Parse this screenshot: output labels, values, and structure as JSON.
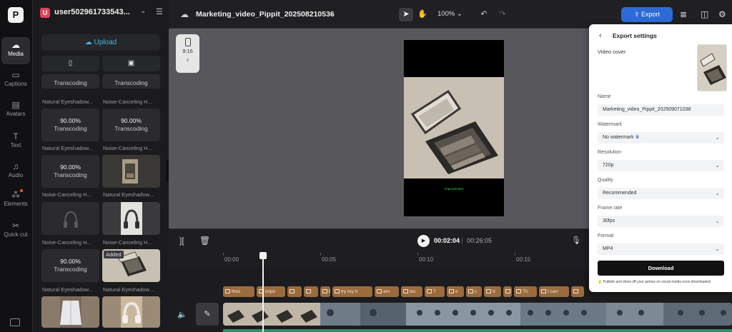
{
  "app": {
    "logo_glyph": "P",
    "user": {
      "initial": "U",
      "name": "user502961733543..."
    }
  },
  "rail": {
    "items": [
      {
        "id": "media",
        "label": "Media",
        "icon": "cloud-icon",
        "active": true
      },
      {
        "id": "captions",
        "label": "Captions",
        "icon": "captions-icon",
        "active": false
      },
      {
        "id": "avatars",
        "label": "Avatars",
        "icon": "avatar-icon",
        "active": false
      },
      {
        "id": "text",
        "label": "Text",
        "icon": "text-icon",
        "active": false
      },
      {
        "id": "audio",
        "label": "Audio",
        "icon": "music-icon",
        "active": false
      },
      {
        "id": "elements",
        "label": "Elements",
        "icon": "elements-icon",
        "active": false
      },
      {
        "id": "quickcut",
        "label": "Quick cut",
        "icon": "scissors-icon",
        "active": false
      }
    ]
  },
  "panel": {
    "upload_label": "Upload",
    "media_items": [
      {
        "caption": "Natural Eyeshadow...",
        "progress": "",
        "status": "Transcoding"
      },
      {
        "caption": "Noise-Canceling H...",
        "progress": "",
        "status": "Transcoding"
      },
      {
        "caption": "Natural Eyeshadow...",
        "progress": "90.00%",
        "status": "Transcoding"
      },
      {
        "caption": "Noise-Canceling H...",
        "progress": "90.00%",
        "status": "Transcoding"
      },
      {
        "caption": "Noise-Canceling H...",
        "progress": "90.00%",
        "status": "Transcoding"
      },
      {
        "caption": "Natural Eyeshadow...",
        "progress": "",
        "status": ""
      },
      {
        "caption": "Noise-Canceling H...",
        "progress": "",
        "status": ""
      },
      {
        "caption": "Noise-Canceling H...",
        "progress": "",
        "status": ""
      },
      {
        "caption": "Natural Eyeshadow...",
        "progress": "90.00%",
        "status": "Transcoding"
      },
      {
        "caption": "Natural Eyeshadow...",
        "progress": "",
        "status": "",
        "tag": "Added"
      }
    ]
  },
  "topbar": {
    "project_title": "Marketing_video_Pippit_202508210536",
    "zoom": "100%",
    "export_label": "Export"
  },
  "preview": {
    "ratio": "9:16",
    "caption_text": "Improvement"
  },
  "timeline": {
    "current_time": "00:02:04",
    "total_time": "00:26:05",
    "ruler": [
      "00:00",
      "00:05",
      "00:10",
      "00:15"
    ],
    "text_clips": [
      "thes",
      "impo",
      "",
      "",
      "E",
      "try my h",
      "am",
      "tec",
      "T",
      "e",
      "c",
      "d",
      "",
      "Th",
      "I can",
      ""
    ]
  },
  "export_settings": {
    "title": "Export settings",
    "video_cover_label": "Video cover",
    "name_label": "Name",
    "name_value": "Marketing_video_Pippit_202509071038",
    "watermark_label": "Watermark",
    "watermark_value": "No watermark",
    "resolution_label": "Resolution",
    "resolution_value": "720p",
    "quality_label": "Quality",
    "quality_value": "Recommended",
    "framerate_label": "Frame rate",
    "framerate_value": "30fps",
    "format_label": "Format",
    "format_value": "MP4",
    "download_label": "Download",
    "note": "Publish and show off your genius on social media once downloaded."
  }
}
